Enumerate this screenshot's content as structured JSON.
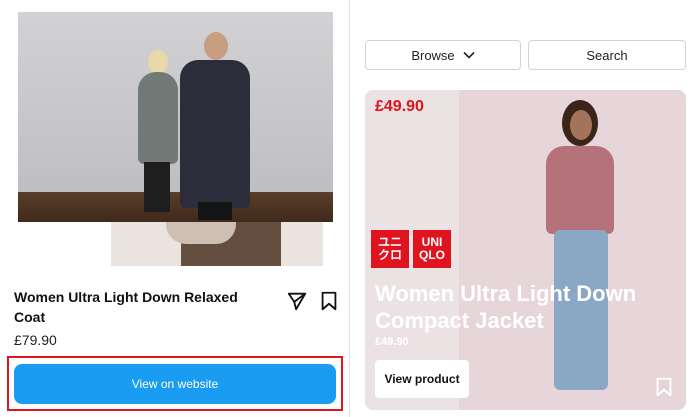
{
  "left_post": {
    "title": "Women Ultra Light Down Relaxed Coat",
    "price": "£79.90",
    "cta_label": "View on website",
    "icons": [
      "paper-plane-icon",
      "bookmark-icon"
    ]
  },
  "right_post": {
    "browse_label": "Browse",
    "search_label": "Search",
    "price_top": "£49.90",
    "logo_jp": "ユニ\nクロ",
    "logo_en": "UNI\nQLO",
    "title": "Women Ultra Light Down Compact Jacket",
    "price": "£49.90",
    "cta_label": "View product",
    "icons": [
      "chevron-down-icon",
      "bookmark-icon"
    ]
  },
  "colors": {
    "accent_blue": "#1a9cf2",
    "brand_red": "#e0141e",
    "highlight_red": "#e0141e"
  }
}
